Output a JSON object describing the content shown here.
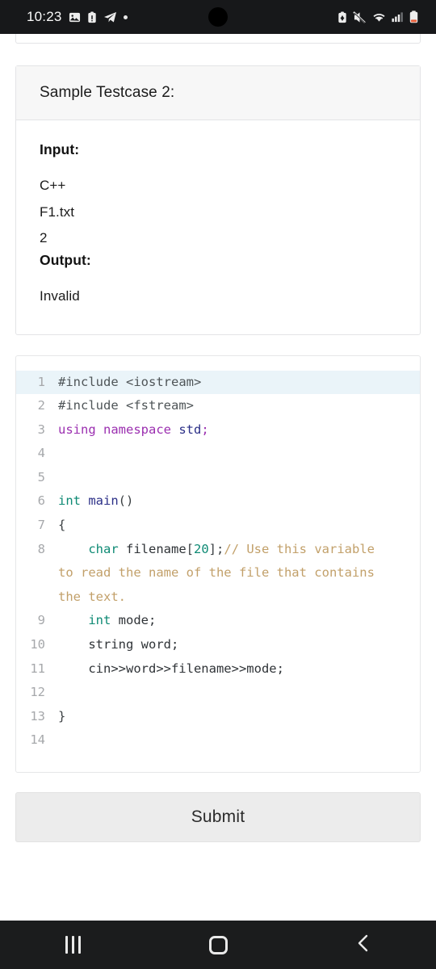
{
  "statusbar": {
    "time": "10:23",
    "left_icons": [
      "image-icon",
      "clipboard-alert-icon",
      "telegram-icon",
      "dot-icon"
    ],
    "right_icons": [
      "battery-saver-icon",
      "mute-vibrate-icon",
      "wifi-icon",
      "signal-icon",
      "battery-icon"
    ]
  },
  "testcase_card": {
    "header": "Sample Testcase 2:",
    "input_label": "Input:",
    "input_lines": [
      "C++",
      "F1.txt",
      "2"
    ],
    "output_label": "Output:",
    "output_lines": [
      "Invalid"
    ]
  },
  "editor": {
    "highlighted_line": 1,
    "line_numbers": [
      "1",
      "2",
      "3",
      "4",
      "5",
      "6",
      "7",
      "8",
      "9",
      "10",
      "11",
      "12",
      "13",
      "14"
    ],
    "lines": [
      {
        "n": "1",
        "tokens": [
          {
            "t": "#include ",
            "c": "k-pre"
          },
          {
            "t": "<iostream>",
            "c": "k-hdr"
          }
        ]
      },
      {
        "n": "2",
        "tokens": [
          {
            "t": "#include ",
            "c": "k-pre"
          },
          {
            "t": "<fstream>",
            "c": "k-hdr"
          }
        ]
      },
      {
        "n": "3",
        "tokens": [
          {
            "t": "using namespace ",
            "c": "k-kw"
          },
          {
            "t": "std",
            "c": "k-ns"
          },
          {
            "t": ";",
            "c": "k-kw"
          }
        ]
      },
      {
        "n": "4",
        "tokens": []
      },
      {
        "n": "5",
        "tokens": []
      },
      {
        "n": "6",
        "tokens": [
          {
            "t": "int ",
            "c": "k-type"
          },
          {
            "t": "main",
            "c": "k-fn"
          },
          {
            "t": "()",
            "c": "k-punct"
          }
        ]
      },
      {
        "n": "7",
        "tokens": [
          {
            "t": "{",
            "c": "k-punct"
          }
        ]
      },
      {
        "n": "8",
        "tokens": [
          {
            "t": "    char ",
            "c": "k-type"
          },
          {
            "t": "filename",
            "c": "k-id"
          },
          {
            "t": "[",
            "c": "k-punct"
          },
          {
            "t": "20",
            "c": "k-num"
          },
          {
            "t": "]",
            "c": "k-punct"
          },
          {
            "t": ";",
            "c": "k-punct"
          },
          {
            "t": "// Use this variable to read the name of the file that contains the text.",
            "c": "k-cmt"
          }
        ]
      },
      {
        "n": "9",
        "tokens": [
          {
            "t": "    int ",
            "c": "k-type"
          },
          {
            "t": "mode;",
            "c": "k-id"
          }
        ]
      },
      {
        "n": "10",
        "tokens": [
          {
            "t": "    string word;",
            "c": "k-id"
          }
        ]
      },
      {
        "n": "11",
        "tokens": [
          {
            "t": "    cin>>word>>filename>>mode;",
            "c": "k-id"
          }
        ]
      },
      {
        "n": "12",
        "tokens": []
      },
      {
        "n": "13",
        "tokens": [
          {
            "t": "}",
            "c": "k-punct"
          }
        ]
      },
      {
        "n": "14",
        "tokens": []
      }
    ]
  },
  "submit": {
    "label": "Submit"
  },
  "navbar": {
    "recents": "recents-icon",
    "home": "home-icon",
    "back": "back-icon"
  },
  "colors": {
    "status_bg": "#17181a",
    "nav_bg": "#1b1c1d",
    "card_header_bg": "#f7f7f7",
    "card_border": "#e3e4e6",
    "highlight_line": "#eaf4f9",
    "submit_bg": "#ececec"
  }
}
